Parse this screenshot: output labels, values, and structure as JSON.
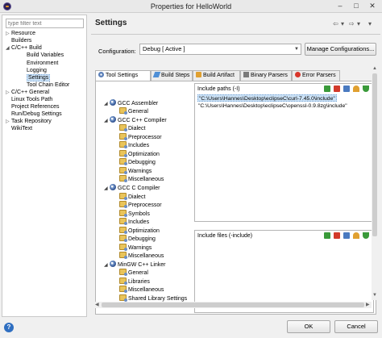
{
  "window": {
    "title": "Properties for HelloWorld",
    "minimize": "–",
    "maximize": "□",
    "close": "✕"
  },
  "left": {
    "filter_placeholder": "type filter text",
    "items": [
      {
        "label": "Resource",
        "expander": "▷"
      },
      {
        "label": "Builders",
        "expander": ""
      },
      {
        "label": "C/C++ Build",
        "expander": "◢"
      },
      {
        "label": "Build Variables",
        "expander": ""
      },
      {
        "label": "Environment",
        "expander": ""
      },
      {
        "label": "Logging",
        "expander": ""
      },
      {
        "label": "Settings",
        "expander": ""
      },
      {
        "label": "Tool Chain Editor",
        "expander": ""
      },
      {
        "label": "C/C++ General",
        "expander": "▷"
      },
      {
        "label": "Linux Tools Path",
        "expander": ""
      },
      {
        "label": "Project References",
        "expander": ""
      },
      {
        "label": "Run/Debug Settings",
        "expander": ""
      },
      {
        "label": "Task Repository",
        "expander": "▷"
      },
      {
        "label": "WikiText",
        "expander": ""
      }
    ]
  },
  "settings": {
    "title": "Settings",
    "back": "⇦",
    "back_menu": "▾",
    "forward": "⇨",
    "forward_menu": "▾",
    "view_menu": "▾",
    "config_label": "Configuration:",
    "config_value": "Debug  [ Active ]",
    "config_arrow": "▼",
    "manage_label": "Manage Configurations..."
  },
  "tabs": [
    {
      "label": "Tool Settings",
      "icon_color": "#5a7fb8"
    },
    {
      "label": "Build Steps",
      "icon_color": "#4f8fd6"
    },
    {
      "label": "Build Artifact",
      "icon_color": "#e0a030"
    },
    {
      "label": "Binary Parsers",
      "icon_color": "#7a7a7a"
    },
    {
      "label": "Error Parsers",
      "icon_color": "#d9362b"
    }
  ],
  "tool_tree": [
    {
      "label": "GCC Assembler",
      "expander": "◢"
    },
    {
      "label": "General",
      "expander": ""
    },
    {
      "label": "GCC C++ Compiler",
      "expander": "◢"
    },
    {
      "label": "Dialect",
      "expander": ""
    },
    {
      "label": "Preprocessor",
      "expander": ""
    },
    {
      "label": "Includes",
      "expander": ""
    },
    {
      "label": "Optimization",
      "expander": ""
    },
    {
      "label": "Debugging",
      "expander": ""
    },
    {
      "label": "Warnings",
      "expander": ""
    },
    {
      "label": "Miscellaneous",
      "expander": ""
    },
    {
      "label": "GCC C Compiler",
      "expander": "◢"
    },
    {
      "label": "Dialect",
      "expander": ""
    },
    {
      "label": "Preprocessor",
      "expander": ""
    },
    {
      "label": "Symbols",
      "expander": ""
    },
    {
      "label": "Includes",
      "expander": ""
    },
    {
      "label": "Optimization",
      "expander": ""
    },
    {
      "label": "Debugging",
      "expander": ""
    },
    {
      "label": "Warnings",
      "expander": ""
    },
    {
      "label": "Miscellaneous",
      "expander": ""
    },
    {
      "label": "MinGW C++ Linker",
      "expander": "◢"
    },
    {
      "label": "General",
      "expander": ""
    },
    {
      "label": "Libraries",
      "expander": ""
    },
    {
      "label": "Miscellaneous",
      "expander": ""
    },
    {
      "label": "Shared Library Settings",
      "expander": ""
    }
  ],
  "include_paths": {
    "label": "Include paths (-I)",
    "items": [
      "\"C:\\Users\\Hannes\\Desktop\\eclipseC\\curl-7.45.0\\include\"",
      "\"C:\\Users\\Hannes\\Desktop\\eclipseC\\openssl-0.9.8zg\\include\""
    ]
  },
  "include_files": {
    "label": "Include files (-include)",
    "items": []
  },
  "toolbar_colors": [
    "#3a9a3a",
    "#d23a2a",
    "#4a7ac0",
    "#e0a030",
    "#3a9a3a"
  ],
  "scroll": {
    "up": "▲",
    "down": "▼",
    "left": "◀",
    "right": "▶"
  },
  "buttons": {
    "help": "?",
    "ok": "OK",
    "cancel": "Cancel"
  }
}
